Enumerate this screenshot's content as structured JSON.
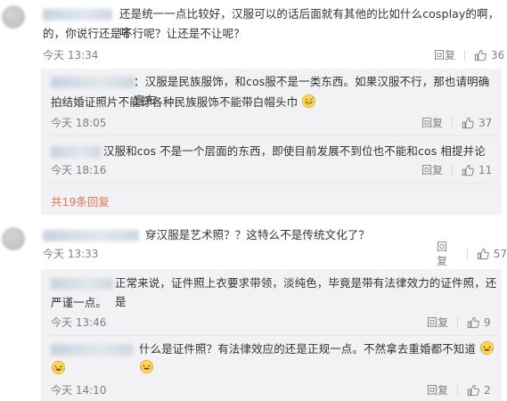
{
  "comments": [
    {
      "text": "还是统一一点比较好，汉服可以的话后面就有其他的比如什么cosplay的啊，啥的，你说行还是不行呢？让还是不让呢？",
      "line1": "还是统一一点比较好，汉服可以的话后面就有其他的比如什么cosplay的啊，啥",
      "line2": "的，你说行还是不行呢？让还是不让呢？",
      "time": "今天 13:34",
      "reply_label": "回复",
      "likes": "36",
      "replies": [
        {
          "line1": "：汉服是民族服饰，和cos服不是一类东西。如果汉服不行，那也请明确宣布",
          "line2": "拍结婚证照片不能穿各种民族服饰不能带白帽头巾",
          "emoji": "sweat-smile-emoji",
          "time": "今天 18:05",
          "reply_label": "回复",
          "likes": "37"
        },
        {
          "line1": "汉服和cos 不是一个层面的东西，即使目前发展不到位也不能和cos 相提并论",
          "time": "今天 18:16",
          "reply_label": "回复",
          "likes": "11"
        }
      ],
      "more_replies": "共19条回复"
    },
    {
      "text": "穿汉服是艺术照？？这特么不是传统文化了？",
      "time": "今天 13:33",
      "reply_label": "回复",
      "likes": "57",
      "replies": [
        {
          "line1": "正常来说，证件照上衣要求带领，淡纯色，毕竟是带有法律效力的证件照，还是",
          "line2": "严谨一点。",
          "time": "今天 13:46",
          "reply_label": "回复",
          "likes": "9"
        },
        {
          "line1": "什么是证件照？有法律效应的还是正规一点。不然拿去重婚都不知道",
          "emoji": "laughing-tears-emoji",
          "time": "今天 14:10",
          "reply_label": "回复",
          "likes": "2"
        }
      ]
    }
  ],
  "colors": {
    "text": "#333333",
    "meta": "#808080",
    "reply_bg": "#f2f2f5",
    "link": "#eb7350",
    "divider": "#e6e6e6"
  }
}
